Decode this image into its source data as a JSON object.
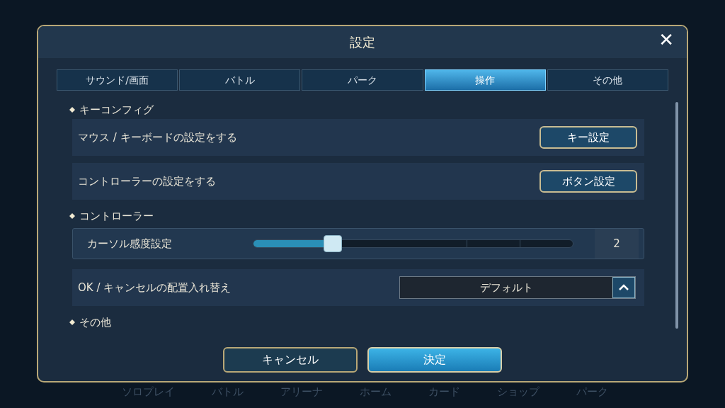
{
  "background_nav": [
    "ソロプレイ",
    "バトル",
    "アリーナ",
    "ホーム",
    "カード",
    "ショップ",
    "パーク"
  ],
  "dialog": {
    "title": "設定",
    "close": "✕"
  },
  "tabs": [
    {
      "label": "サウンド/画面",
      "selected": false
    },
    {
      "label": "バトル",
      "selected": false
    },
    {
      "label": "パーク",
      "selected": false
    },
    {
      "label": "操作",
      "selected": true
    },
    {
      "label": "その他",
      "selected": false
    }
  ],
  "sections": [
    {
      "heading": "キーコンフィグ",
      "rows": [
        {
          "kind": "button",
          "label": "マウス / キーボードの設定をする",
          "button": "キー設定"
        },
        {
          "kind": "button",
          "label": "コントローラーの設定をする",
          "button": "ボタン設定"
        }
      ]
    },
    {
      "heading": "コントローラー",
      "rows": [
        {
          "kind": "slider",
          "label": "カーソル感度設定",
          "level": 0.25,
          "reading": "2"
        },
        {
          "kind": "dropdown",
          "label": "OK / キャンセルの配置入れ替え",
          "value": "デフォルト"
        }
      ]
    },
    {
      "heading": "その他"
    }
  ],
  "buttons": [
    {
      "label": "キャンセル",
      "primary": false
    },
    {
      "label": "決定",
      "primary": true
    }
  ]
}
